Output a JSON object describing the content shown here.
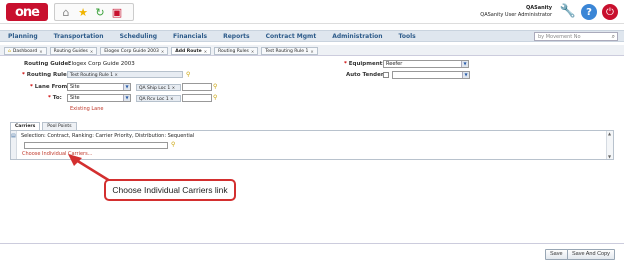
{
  "header": {
    "logo_text": "one",
    "user_name": "QASanity",
    "user_role": "QASanity User Administrator",
    "quick_icons": [
      "home-icon",
      "star-icon",
      "refresh-icon",
      "report-icon"
    ]
  },
  "nav": {
    "items": [
      "Planning",
      "Transportation",
      "Scheduling",
      "Financials",
      "Reports",
      "Contract Mgmt",
      "Administration",
      "Tools"
    ],
    "search_placeholder": "by Movement No"
  },
  "tabs": [
    {
      "label": "Dashboard",
      "active": false
    },
    {
      "label": "Routing Guides",
      "active": false
    },
    {
      "label": "Elogex Corp Guide 2003",
      "active": false
    },
    {
      "label": "Add Route",
      "active": true
    },
    {
      "label": "Routing Rules",
      "active": false
    },
    {
      "label": "Test Routing Rule 1",
      "active": false
    }
  ],
  "form": {
    "routing_guide_label": "Routing Guide:",
    "routing_guide_value": "Elogex Corp Guide 2003",
    "routing_rule_label": "Routing Rule:",
    "routing_rule_value": "Test Routing Rule 1",
    "lane_from_label": "Lane From:",
    "lane_from_type": "Site",
    "lane_from_chip": "QA Ship Loc 1",
    "to_label": "To:",
    "to_type": "Site",
    "to_chip": "QA Rcv Loc 1",
    "existing_lane": "Existing Lane",
    "equipment_label": "Equipment:",
    "equipment_value": "Reefer",
    "auto_tender_label": "Auto Tender:"
  },
  "subtabs": [
    {
      "label": "Carriers",
      "active": true
    },
    {
      "label": "Pool Points",
      "active": false
    }
  ],
  "carriers": {
    "selection_text": "Selection: Contract, Ranking: Carrier Priority, Distribution: Sequential",
    "choose_link": "Choose Individual Carriers..."
  },
  "callout": {
    "text": "Choose Individual Carriers link",
    "color": "#d32f2f"
  },
  "footer": {
    "save_label": "Save",
    "save_copy_label": "Save And Copy"
  }
}
